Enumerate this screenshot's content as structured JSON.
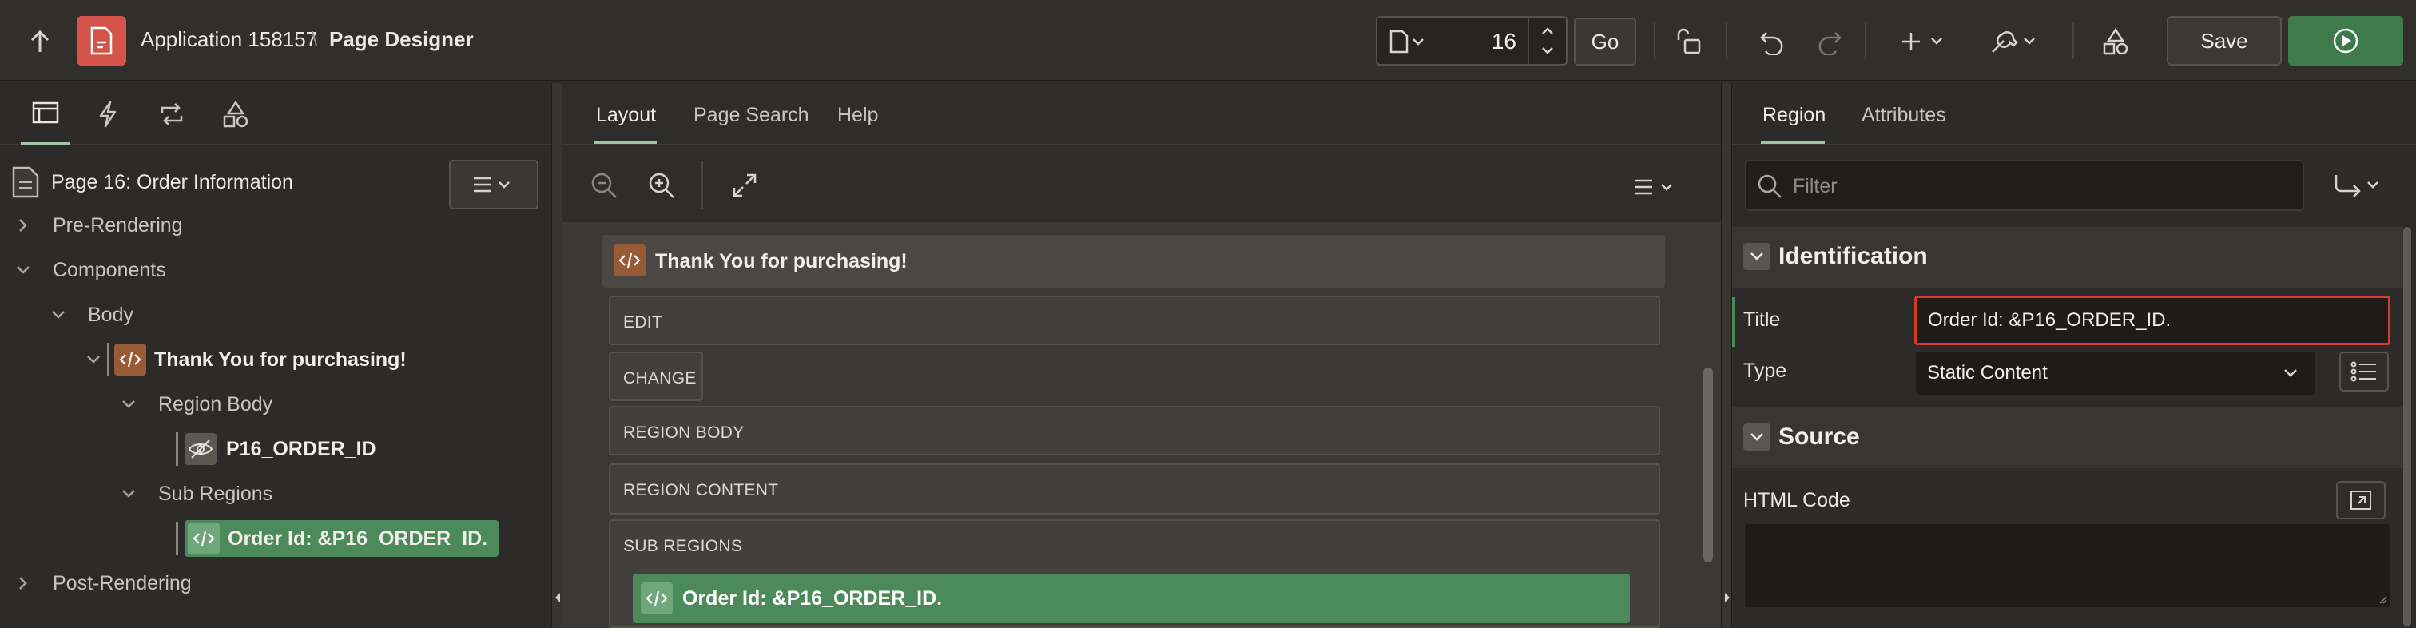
{
  "header": {
    "app_name": "Application 158157",
    "separator": "\\",
    "page_title": "Page Designer",
    "page_number": "16",
    "go_label": "Go",
    "save_label": "Save"
  },
  "left_panel": {
    "page_node": "Page 16: Order Information",
    "tree": {
      "pre_rendering": "Pre-Rendering",
      "components": "Components",
      "body": "Body",
      "thank_you_region": "Thank You for purchasing!",
      "region_body": "Region Body",
      "order_item": "P16_ORDER_ID",
      "sub_regions": "Sub Regions",
      "order_region": "Order Id: &P16_ORDER_ID.",
      "post_rendering": "Post-Rendering"
    }
  },
  "center_panel": {
    "tabs": [
      "Layout",
      "Page Search",
      "Help"
    ],
    "region_title": "Thank You for purchasing!",
    "positions": [
      "EDIT",
      "CHANGE",
      "REGION BODY",
      "REGION CONTENT",
      "SUB REGIONS"
    ],
    "sub_region_title": "Order Id: &P16_ORDER_ID."
  },
  "right_panel": {
    "tabs": [
      "Region",
      "Attributes"
    ],
    "filter_placeholder": "Filter",
    "identification": {
      "heading": "Identification",
      "title_label": "Title",
      "title_value": "Order Id: &P16_ORDER_ID.",
      "type_label": "Type",
      "type_value": "Static Content"
    },
    "source": {
      "heading": "Source",
      "html_code_label": "HTML Code",
      "html_code_value": ""
    }
  },
  "colors": {
    "accent_green": "#4d8a5b",
    "app_icon_red": "#d4544a",
    "region_icon_brown": "#9a5a36",
    "title_field_border": "#d33a2c"
  }
}
